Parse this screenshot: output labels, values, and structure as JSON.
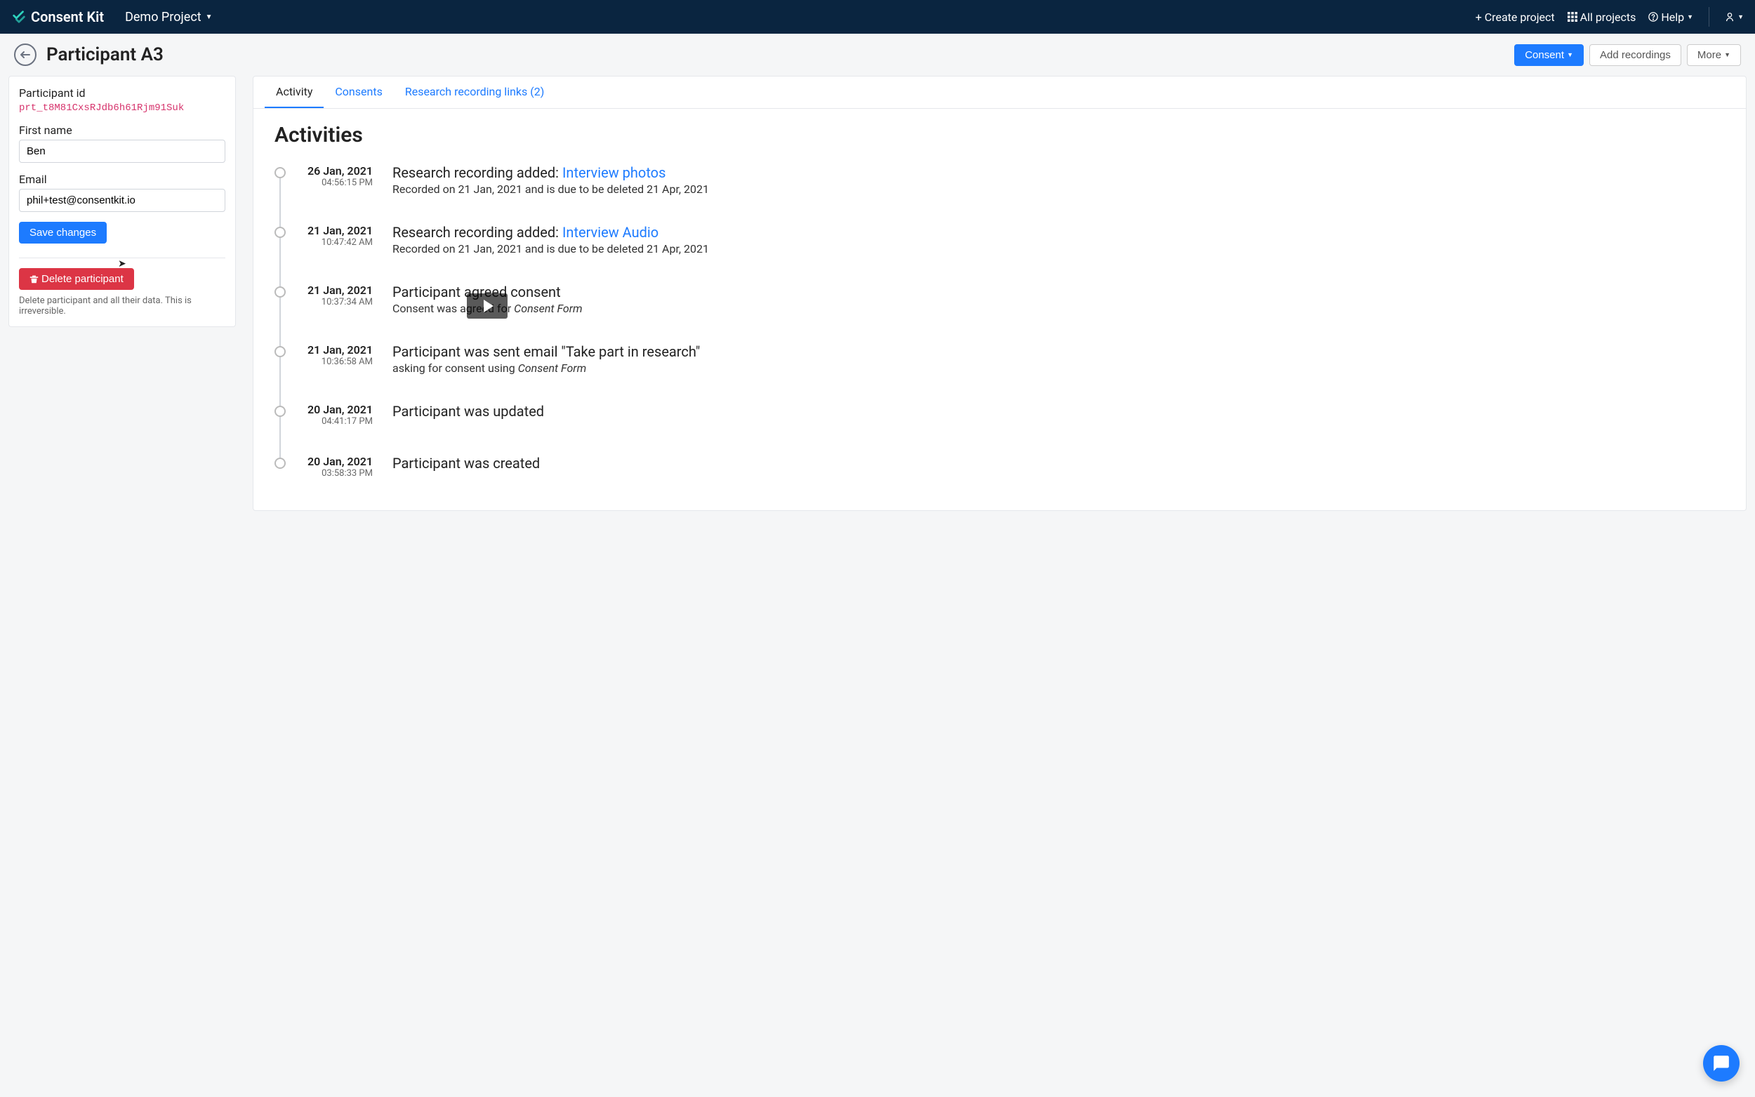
{
  "header": {
    "brand": "Consent Kit",
    "project": "Demo Project",
    "create_project": "Create project",
    "all_projects": "All projects",
    "help": "Help"
  },
  "page": {
    "title": "Participant A3",
    "consent_btn": "Consent",
    "add_recordings_btn": "Add recordings",
    "more_btn": "More"
  },
  "sidebar": {
    "participant_id_label": "Participant id",
    "participant_id": "prt_t8M81CxsRJdb6h61Rjm91Suk",
    "first_name_label": "First name",
    "first_name_value": "Ben",
    "email_label": "Email",
    "email_value": "phil+test@consentkit.io",
    "save_btn": "Save changes",
    "delete_btn": "Delete participant",
    "delete_hint": "Delete participant and all their data. This is irreversible."
  },
  "tabs": {
    "activity": "Activity",
    "consents": "Consents",
    "recordings": "Research recording links (2)"
  },
  "activities_title": "Activities",
  "activities": [
    {
      "date": "26 Jan, 2021",
      "time": "04:56:15 PM",
      "title_prefix": "Research recording added: ",
      "title_link": "Interview photos",
      "desc": "Recorded on 21 Jan, 2021 and is due to be deleted 21 Apr, 2021"
    },
    {
      "date": "21 Jan, 2021",
      "time": "10:47:42 AM",
      "title_prefix": "Research recording added: ",
      "title_link": "Interview Audio",
      "desc": "Recorded on 21 Jan, 2021 and is due to be deleted 21 Apr, 2021"
    },
    {
      "date": "21 Jan, 2021",
      "time": "10:37:34 AM",
      "title_plain": "Participant agreed consent",
      "desc_prefix": "Consent was agreed for ",
      "desc_em": "Consent Form"
    },
    {
      "date": "21 Jan, 2021",
      "time": "10:36:58 AM",
      "title_plain": "Participant was sent email \"Take part in research\"",
      "desc_prefix": "asking for consent using ",
      "desc_em": "Consent Form"
    },
    {
      "date": "20 Jan, 2021",
      "time": "04:41:17 PM",
      "title_plain": "Participant was updated"
    },
    {
      "date": "20 Jan, 2021",
      "time": "03:58:33 PM",
      "title_plain": "Participant was created"
    }
  ]
}
